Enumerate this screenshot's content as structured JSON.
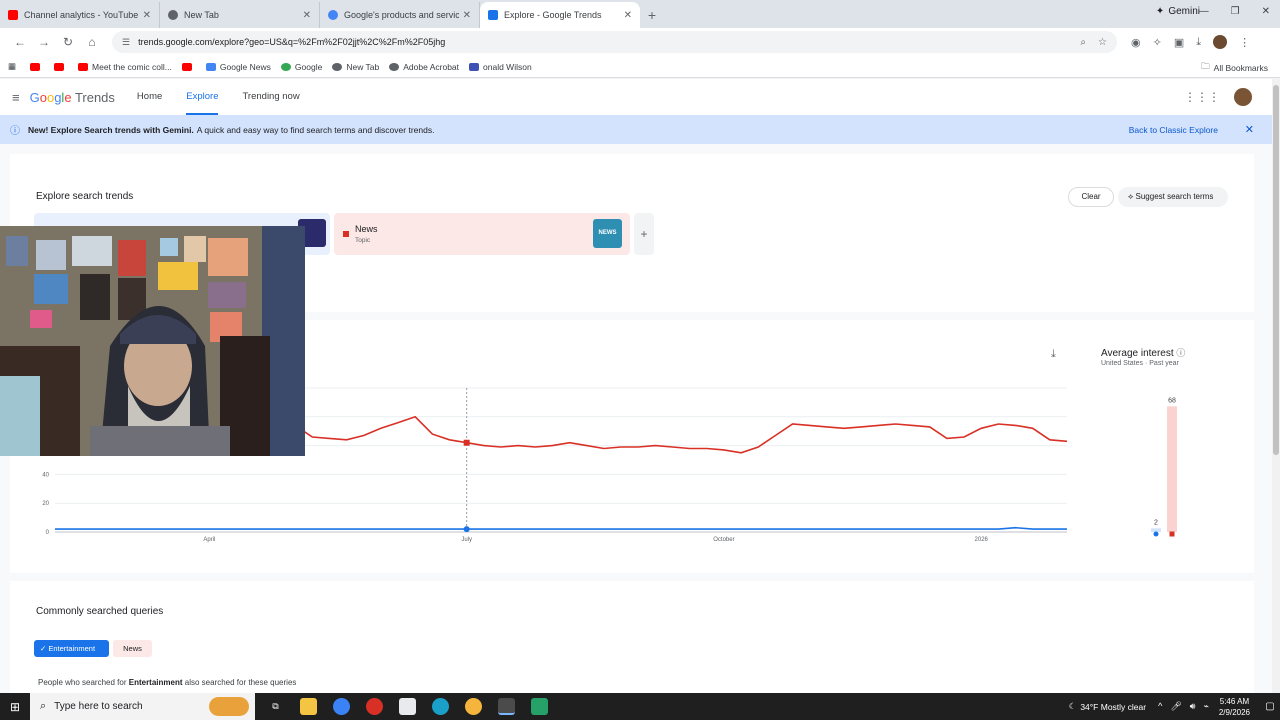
{
  "browser": {
    "tabs": [
      {
        "title": "Channel analytics - YouTube Studio",
        "favicon_color": "#ff0000",
        "active": false
      },
      {
        "title": "New Tab",
        "favicon_color": "#5f6368",
        "active": false
      },
      {
        "title": "Google's products and services",
        "favicon_color": "#4285f4",
        "active": false
      },
      {
        "title": "Explore - Google Trends",
        "favicon_color": "#1a73e8",
        "active": true
      }
    ],
    "new_tab_symbol": "+",
    "gemini_label": "Gemini",
    "url": "trends.google.com/explore?geo=US&q=%2Fm%2F02jjt%2C%2Fm%2F05jhg",
    "bookmarks": [
      {
        "label": "",
        "color": "#ff0000"
      },
      {
        "label": "",
        "color": "#ff0000"
      },
      {
        "label": "Meet the comic coll...",
        "color": "#ff0000"
      },
      {
        "label": "",
        "color": "#ff0000"
      },
      {
        "label": "Google News",
        "color": "#4285f4"
      },
      {
        "label": "Google",
        "color": "#34a853"
      },
      {
        "label": "New Tab",
        "color": "#5f6368"
      },
      {
        "label": "Adobe Acrobat",
        "color": "#5f6368"
      },
      {
        "label": "onald Wilson",
        "color": "#3f51b5"
      }
    ],
    "all_bookmarks": "All Bookmarks"
  },
  "app": {
    "logo_google": "Google",
    "logo_trends": "Trends",
    "nav": [
      {
        "label": "Home",
        "active": false
      },
      {
        "label": "Explore",
        "active": true
      },
      {
        "label": "Trending now",
        "active": false
      }
    ],
    "banner": {
      "bold": "New! Explore Search trends with Gemini.",
      "text": "A quick and easy way to find search terms and discover trends.",
      "back": "Back to Classic Explore"
    },
    "explore": {
      "title": "Explore search trends",
      "clear": "Clear",
      "suggest": "Suggest search terms",
      "term2_name": "News",
      "term2_type": "Topic",
      "term2_thumb": "NEWS",
      "add": "+"
    },
    "average": {
      "title": "Average interest",
      "region": "United States",
      "period": "Past year",
      "values": [
        {
          "label": "2",
          "value": 2,
          "color": "#1a73e8"
        },
        {
          "label": "68",
          "value": 68,
          "color": "#d93025"
        }
      ]
    },
    "queries": {
      "title": "Commonly searched queries",
      "chip_active": "Entertainment",
      "chip_other": "News",
      "people_prefix": "People who searched for",
      "people_term": "Entertainment",
      "people_suffix": "also searched for these queries"
    }
  },
  "chart_data": {
    "type": "line",
    "x_tick_labels": [
      "April",
      "July",
      "October",
      "2026"
    ],
    "y_tick_labels": [
      "0",
      "20",
      "40"
    ],
    "ylim": [
      0,
      100
    ],
    "series": [
      {
        "color": "#d93025",
        "values": [
          59,
          59,
          58,
          57,
          55,
          55,
          57,
          60,
          65,
          69,
          70,
          70,
          73,
          78,
          74,
          66,
          65,
          64,
          67,
          72,
          76,
          80,
          68,
          64,
          62,
          60,
          59,
          60,
          59,
          60,
          62,
          60,
          58,
          59,
          59,
          60,
          59,
          58,
          58,
          57,
          55,
          59,
          67,
          75,
          74,
          73,
          72,
          73,
          74,
          75,
          74,
          73,
          65,
          66,
          72,
          75,
          74,
          72,
          64,
          63
        ]
      },
      {
        "color": "#1a73e8",
        "values": [
          2,
          2,
          2,
          2,
          2,
          2,
          2,
          2,
          2,
          2,
          2,
          2,
          2,
          2,
          2,
          2,
          2,
          2,
          2,
          2,
          2,
          2,
          2,
          2,
          2,
          2,
          2,
          2,
          2,
          2,
          2,
          2,
          2,
          2,
          2,
          2,
          2,
          2,
          2,
          2,
          2,
          2,
          2,
          2,
          2,
          2,
          2,
          2,
          2,
          2,
          2,
          2,
          2,
          2,
          2,
          2,
          3,
          2,
          2,
          2
        ]
      }
    ],
    "hover_index": 24,
    "grid": true
  },
  "taskbar": {
    "search_placeholder": "Type here to search",
    "weather": "34°F  Mostly clear",
    "time": "5:46 AM",
    "date": "2/9/2026"
  }
}
